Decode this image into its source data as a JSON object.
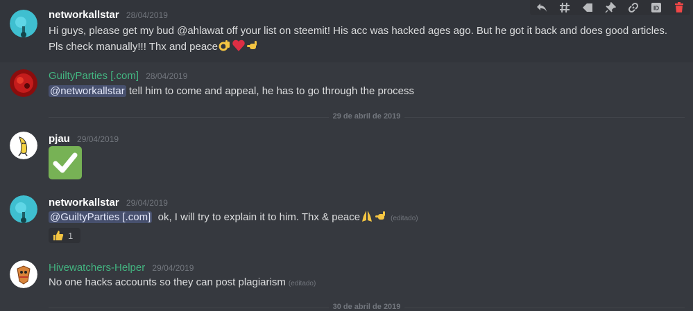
{
  "messages": [
    {
      "author": "networkallstar",
      "timestamp": "28/04/2019",
      "line1": "Hi guys, please get my bud @ahlawat off your list on steemit! His acc was hacked ages ago. But he got it back and does good articles.",
      "line2": "Pls check manually!!! Thx and peace"
    },
    {
      "author": "GuiltyParties [.com]",
      "timestamp": "28/04/2019",
      "mention": "@networkallstar",
      "text": " tell him to come and appeal, he has to go through the process"
    },
    {
      "author": "pjau",
      "timestamp": "29/04/2019"
    },
    {
      "author": "networkallstar",
      "timestamp": "29/04/2019",
      "mention": "@GuiltyParties [.com]",
      "text": "  ok, I will try to explain it to him. Thx & peace",
      "edited": "(editado)",
      "reaction_count": "1"
    },
    {
      "author": "Hivewatchers-Helper",
      "timestamp": "29/04/2019",
      "text": "No one hacks accounts so they can post plagiarism",
      "edited": "(editado)"
    }
  ],
  "dividers": [
    "29 de abril de 2019",
    "30 de abril de 2019"
  ],
  "colors": {
    "background": "#36393f",
    "role_green": "#43b581",
    "mention_bg": "#414675",
    "check_green": "#77b255"
  },
  "toolbar_icons": [
    "reply-icon",
    "thread-icon",
    "tag-icon",
    "pin-icon",
    "link-icon",
    "id-icon",
    "delete-icon"
  ]
}
